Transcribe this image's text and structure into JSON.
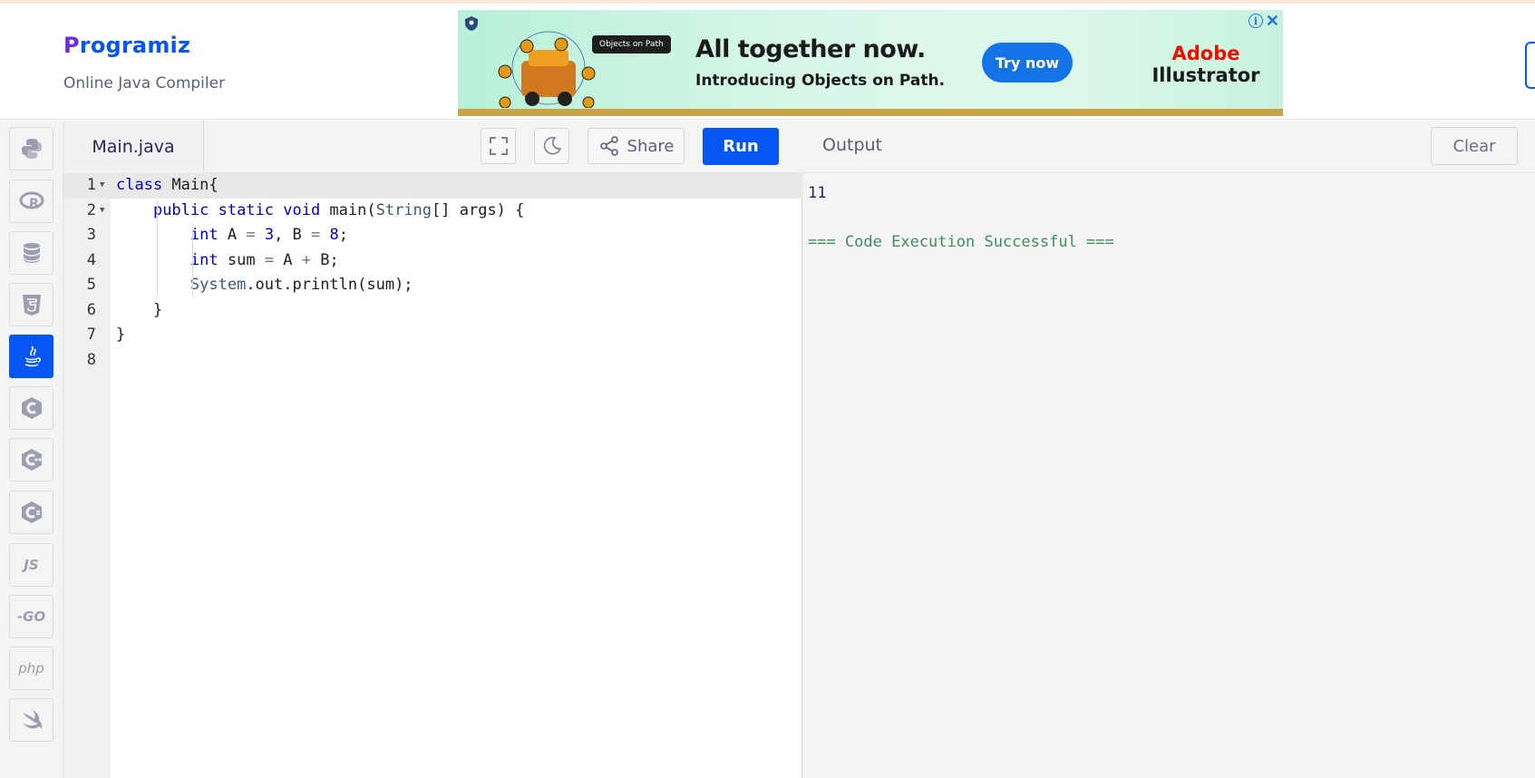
{
  "header": {
    "logo_p": "P",
    "logo_rest": "rogramiz",
    "subtitle": "Online Java Compiler"
  },
  "ad": {
    "chip": "Objects on Path",
    "headline": "All together now.",
    "subline": "Introducing Objects on Path.",
    "cta": "Try now",
    "brand_line1": "Adobe",
    "brand_line2": "Illustrator",
    "info": "i",
    "close": "✕"
  },
  "sidebar": {
    "items": [
      {
        "name": "python",
        "text": ""
      },
      {
        "name": "r",
        "text": ""
      },
      {
        "name": "sql",
        "text": ""
      },
      {
        "name": "html",
        "text": ""
      },
      {
        "name": "java",
        "text": "",
        "active": true
      },
      {
        "name": "c",
        "text": ""
      },
      {
        "name": "cpp",
        "text": ""
      },
      {
        "name": "csharp",
        "text": ""
      },
      {
        "name": "js",
        "text": "JS"
      },
      {
        "name": "go",
        "text": "-GO"
      },
      {
        "name": "php",
        "text": "php"
      },
      {
        "name": "swift",
        "text": ""
      }
    ]
  },
  "editor": {
    "file_name": "Main.java",
    "share_label": "Share",
    "run_label": "Run",
    "lines": [
      {
        "n": "1",
        "fold": true
      },
      {
        "n": "2",
        "fold": true
      },
      {
        "n": "3"
      },
      {
        "n": "4"
      },
      {
        "n": "5"
      },
      {
        "n": "6"
      },
      {
        "n": "7"
      },
      {
        "n": "8"
      }
    ],
    "code": {
      "l1_kw": "class",
      "l1_rest": " Main{",
      "l2_kw": "public static void",
      "l2_rest": " main(",
      "l2_cls": "String",
      "l2_tail": "[] args) {",
      "l3_kw": "int",
      "l3_a": " A ",
      "l3_eq": "=",
      "l3_sp": " ",
      "l3_3": "3",
      "l3_b": ", B ",
      "l3_eq2": "=",
      "l3_sp2": " ",
      "l3_8": "8",
      "l3_end": ";",
      "l4_kw": "int",
      "l4_a": " sum ",
      "l4_eq": "=",
      "l4_b": " A ",
      "l4_plus": "+",
      "l4_end": " B;",
      "l5_cls": "System",
      "l5_rest": ".out.println(sum);",
      "l6": "}",
      "l7": "}"
    }
  },
  "output": {
    "title": "Output",
    "clear_label": "Clear",
    "lines": [
      "11",
      "",
      "=== Code Execution Successful ==="
    ]
  }
}
